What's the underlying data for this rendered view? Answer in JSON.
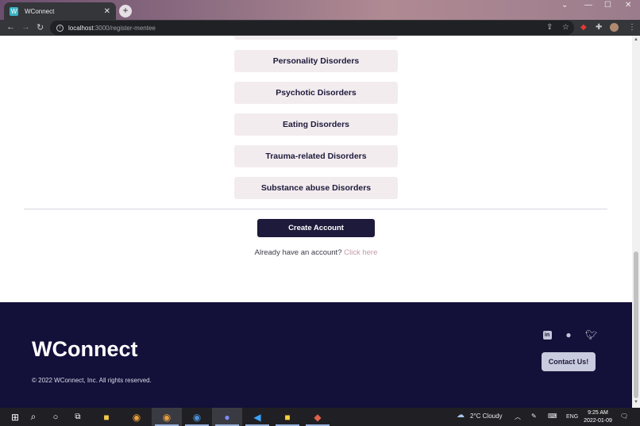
{
  "browser": {
    "tab_title": "WConnect",
    "url_host": "localhost",
    "url_path": ":3000/register-mentee"
  },
  "form": {
    "options": [
      "Personality Disorders",
      "Psychotic Disorders",
      "Eating Disorders",
      "Trauma-related Disorders",
      "Substance abuse Disorders"
    ],
    "create_button": "Create Account",
    "login_prompt": "Already have an account?",
    "login_link": "Click here"
  },
  "footer": {
    "brand": "WConnect",
    "copyright": "© 2022 WConnect, Inc. All rights reserved.",
    "contact_button": "Contact Us!",
    "social_icons": [
      "linkedin-icon",
      "github-icon",
      "twitter-icon"
    ]
  },
  "taskbar": {
    "weather": "2°C  Cloudy",
    "language": "ENG",
    "time": "9:25 AM",
    "date": "2022-01-09"
  },
  "colors": {
    "primary": "#1e1a3b",
    "footer_bg": "#13103a",
    "pill_bg": "#f3ecef",
    "link": "#c49aa7"
  }
}
